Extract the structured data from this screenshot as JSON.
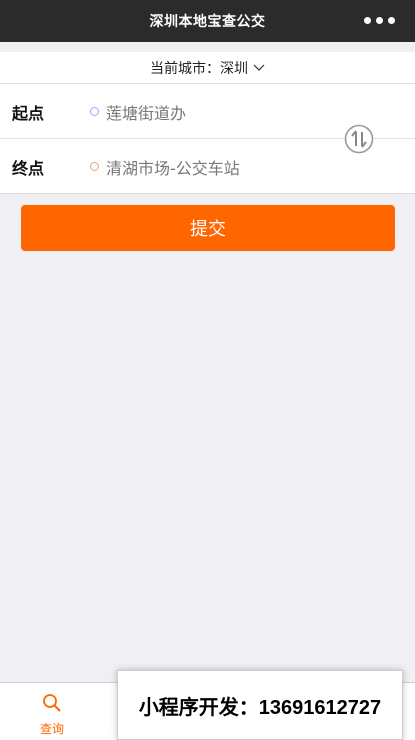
{
  "titlebar": {
    "title": "深圳本地宝查公交",
    "more_icon": "more-dots-icon"
  },
  "city": {
    "label": "当前城市：深圳",
    "icon": "chevron-down-icon"
  },
  "route": {
    "start_label": "起点",
    "start_value": "莲塘街道办",
    "end_label": "终点",
    "end_value": "清湖市场-公交车站",
    "swap_icon": "swap-arrows-icon"
  },
  "submit": {
    "label": "提交"
  },
  "tabbar": {
    "query_label": "查询",
    "query_icon": "search-icon"
  },
  "ad": {
    "text": "小程序开发：13691612727"
  },
  "colors": {
    "accent": "#ff6600",
    "titlebar_bg": "#2b2b2b",
    "page_bg": "#efeff4"
  }
}
